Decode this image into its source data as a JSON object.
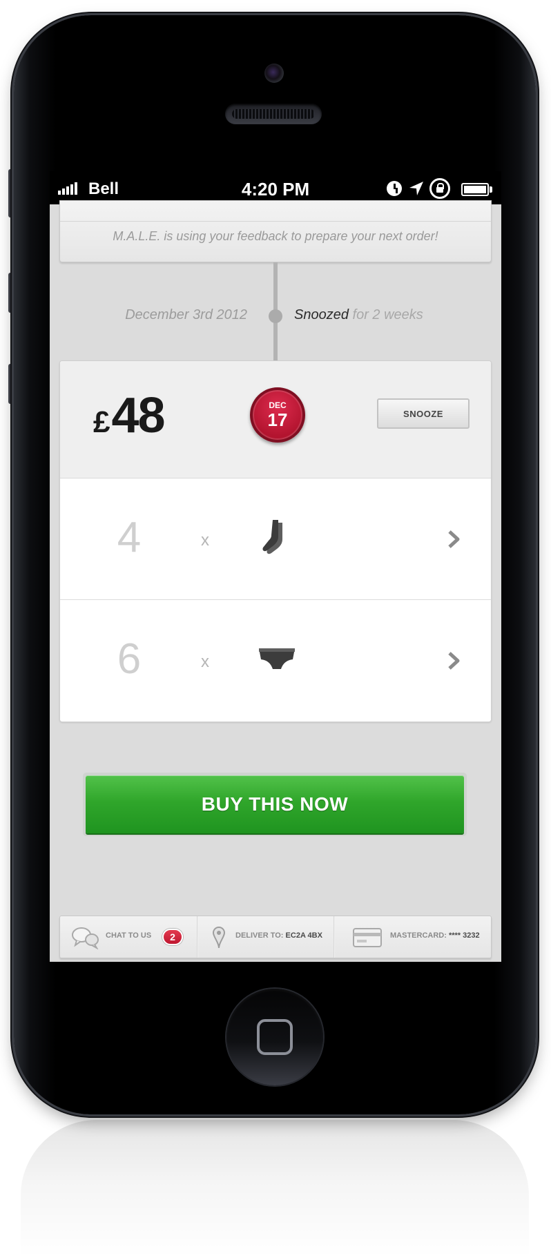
{
  "status_bar": {
    "carrier": "Bell",
    "time": "4:20 PM",
    "icons": [
      "signal-icon",
      "alarm-icon",
      "location-icon",
      "rotation-lock-icon",
      "battery-icon"
    ]
  },
  "feedback": {
    "message": "M.A.L.E. is using your feedback to prepare your next order!"
  },
  "timeline": {
    "date": "December 3rd 2012",
    "status_word": "Snoozed",
    "status_rest": " for 2 weeks"
  },
  "order": {
    "currency": "£",
    "price": "48",
    "date_month": "DEC",
    "date_day": "17",
    "snooze_label": "SNOOZE",
    "items": [
      {
        "quantity": "4",
        "times": "x",
        "icon": "socks-icon"
      },
      {
        "quantity": "6",
        "times": "x",
        "icon": "underwear-icon"
      }
    ]
  },
  "buy_button": {
    "label": "BUY THIS NOW"
  },
  "footer": {
    "chat_label": "CHAT TO US",
    "chat_count": "2",
    "deliver_label": "DELIVER TO:",
    "deliver_value": "EC2A 4BX",
    "card_label": "MASTERCARD:",
    "card_value": "**** 3232"
  },
  "colors": {
    "accent_red": "#c8183a",
    "buy_green": "#2fa52b",
    "background": "#dcdcdc"
  }
}
